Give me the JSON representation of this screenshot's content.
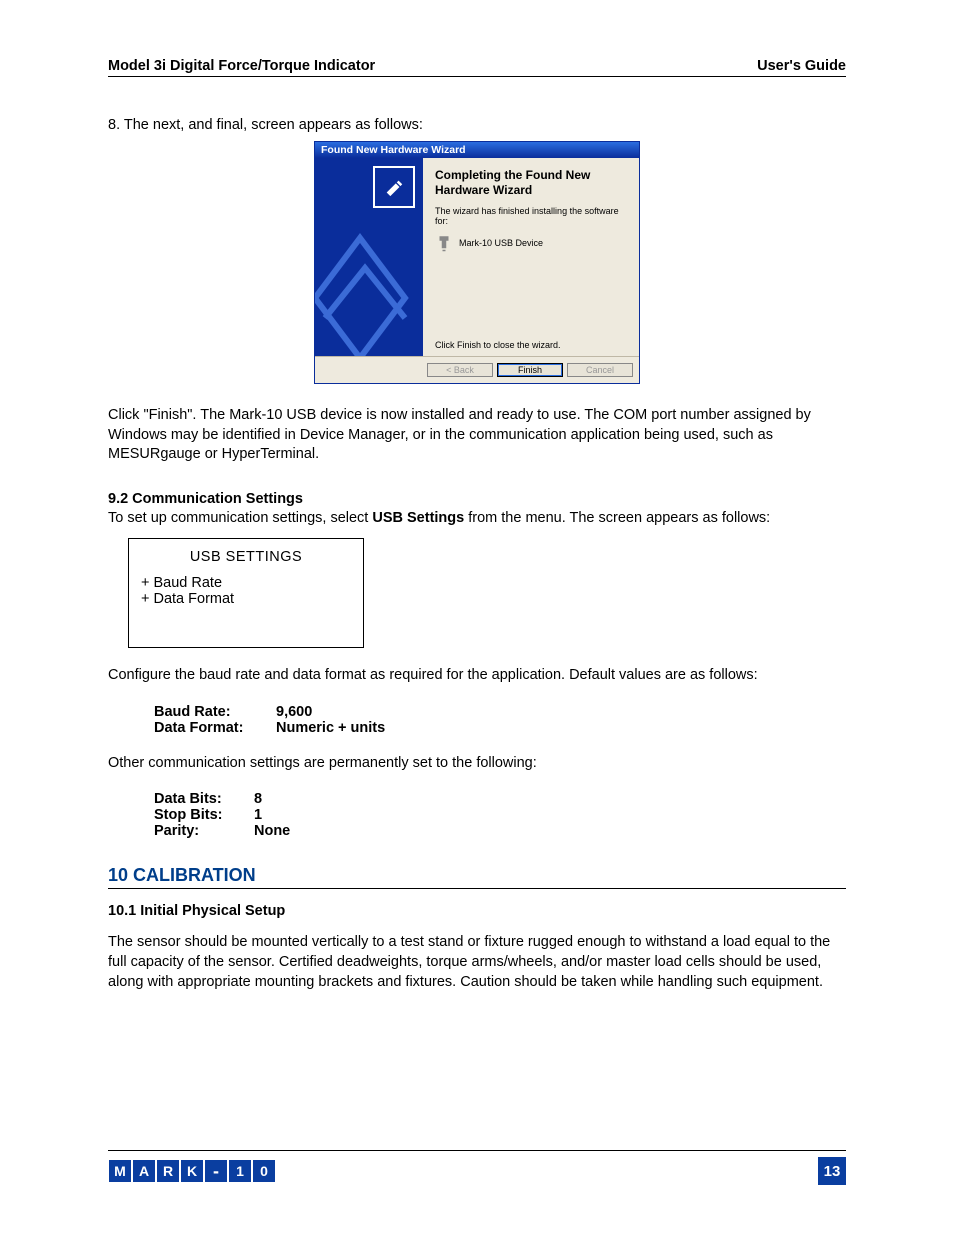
{
  "header": {
    "left": "Model 3i Digital Force/Torque Indicator",
    "right": "User's Guide"
  },
  "step8": "8. The next, and final, screen appears as follows:",
  "wizard": {
    "title": "Found New Hardware Wizard",
    "heading": "Completing the Found New Hardware Wizard",
    "sub": "The wizard has finished installing the software for:",
    "device": "Mark-10 USB Device",
    "finish_note": "Click Finish to close the wizard.",
    "back": "< Back",
    "finish": "Finish",
    "cancel": "Cancel"
  },
  "after_wizard": "Click \"Finish\". The Mark-10 USB device is now installed and ready to use. The COM port number assigned by Windows may be identified in Device Manager, or in the communication application being used, such as MESURgauge or HyperTerminal.",
  "s92_head": "9.2 Communication Settings",
  "s92_intro_a": "To set up communication settings, select ",
  "s92_intro_b": "USB Settings",
  "s92_intro_c": " from the menu. The screen appears as follows:",
  "usb": {
    "title": "USB SETTINGS",
    "item1": "+ Baud Rate",
    "item2": "+ Data Format"
  },
  "config_line": "Configure the baud rate and data format as required for the application. Default values are as follows:",
  "defaults1": [
    {
      "label": "Baud Rate:",
      "val": "9,600"
    },
    {
      "label": "Data Format:",
      "val": "Numeric + units"
    }
  ],
  "perm_line": "Other communication settings are permanently set to the following:",
  "defaults2": [
    {
      "label": "Data Bits:",
      "val": "8"
    },
    {
      "label": "Stop Bits:",
      "val": "1"
    },
    {
      "label": "Parity:",
      "val": "None"
    }
  ],
  "section10": "10   CALIBRATION",
  "s101_head": "10.1 Initial Physical Setup",
  "s101_body": "The sensor should be mounted vertically to a test stand or fixture rugged enough to withstand a load equal to the full capacity of the sensor. Certified deadweights, torque arms/wheels, and/or master load cells should be used, along with appropriate mounting brackets and fixtures. Caution should be taken while handling such equipment.",
  "logo": [
    "M",
    "A",
    "R",
    "K",
    "-",
    "1",
    "0"
  ],
  "page_number": "13"
}
